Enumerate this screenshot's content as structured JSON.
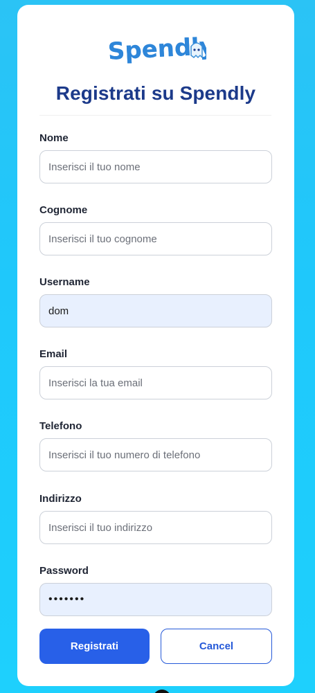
{
  "logo": {
    "text": "Spendly"
  },
  "title": "Registrati su Spendly",
  "form": {
    "fields": [
      {
        "label": "Nome",
        "placeholder": "Inserisci il tuo nome",
        "value": ""
      },
      {
        "label": "Cognome",
        "placeholder": "Inserisci il tuo cognome",
        "value": ""
      },
      {
        "label": "Username",
        "placeholder": "",
        "value": "dom"
      },
      {
        "label": "Email",
        "placeholder": "Inserisci la tua email",
        "value": ""
      },
      {
        "label": "Telefono",
        "placeholder": "Inserisci il tuo numero di telefono",
        "value": ""
      },
      {
        "label": "Indirizzo",
        "placeholder": "Inserisci il tuo indirizzo",
        "value": ""
      },
      {
        "label": "Password",
        "placeholder": "",
        "value": "•••••••"
      }
    ]
  },
  "buttons": {
    "submit": "Registrati",
    "cancel": "Cancel"
  },
  "colors": {
    "background": "#1fc8fb",
    "title": "#1c3a8a",
    "primary": "#2860e8",
    "autofill": "#e8f0fe"
  }
}
